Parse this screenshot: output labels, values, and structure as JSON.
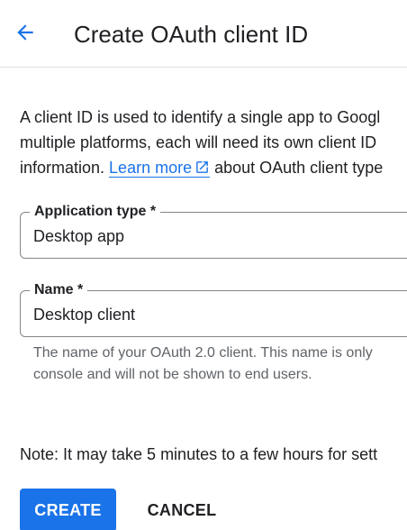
{
  "header": {
    "title": "Create OAuth client ID",
    "back_icon": "arrow-back-icon"
  },
  "intro": {
    "line1": "A client ID is used to identify a single app to Googl",
    "line2": "multiple platforms, each will need its own client ID",
    "line3_before": "information. ",
    "learn_more": "Learn more",
    "line3_after": " about OAuth client type",
    "external_icon": "open-in-new-icon"
  },
  "application_type": {
    "label": "Application type *",
    "value": "Desktop app"
  },
  "name_field": {
    "label": "Name *",
    "value": "Desktop client",
    "hint_line1": "The name of your OAuth 2.0 client. This name is only",
    "hint_line2": "console and will not be shown to end users."
  },
  "note": "Note: It may take 5 minutes to a few hours for sett",
  "actions": {
    "create": "CREATE",
    "cancel": "CANCEL"
  },
  "colors": {
    "accent": "#1a73e8",
    "text": "#202124",
    "muted": "#5f6368",
    "border": "#80868b"
  }
}
